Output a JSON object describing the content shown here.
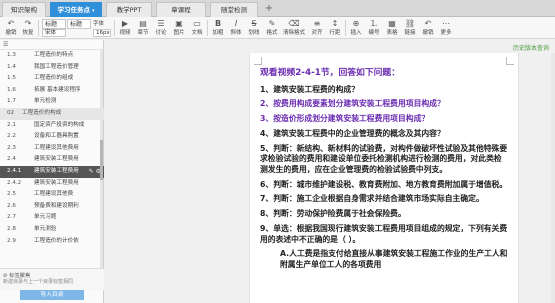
{
  "tabs": [
    {
      "label": "知识架构",
      "active": false
    },
    {
      "label": "学习任务点",
      "active": true,
      "caret": "▾"
    },
    {
      "label": "教学PPT",
      "active": false
    },
    {
      "label": "章课程",
      "active": false
    },
    {
      "label": "随堂检测",
      "active": false
    }
  ],
  "toolbar": {
    "undo": "撤销",
    "redo": "恢复",
    "heading_style": "标题",
    "body_style": "标题",
    "font_family": "宋体",
    "font_size": "16px",
    "font_name_label": "字体",
    "font_size_label": "字号",
    "buttons": [
      "视频",
      "章节",
      "讨论",
      "图片",
      "文档",
      "加粗",
      "斜体",
      "划线",
      "格式",
      "清除格式",
      "对齐",
      "行距",
      "插入",
      "编号",
      "表格",
      "链接",
      "撤销",
      "更多"
    ]
  },
  "sidebar": {
    "label_placeholder": "标签聚焦",
    "label_hint": "新建目录与上一个目录标签相同",
    "import_button": "导入目录",
    "rows": [
      {
        "num": "1.3",
        "text": "工程造价的特点",
        "type": "item"
      },
      {
        "num": "1.4",
        "text": "我国工程造价管理",
        "type": "item"
      },
      {
        "num": "1.5",
        "text": "工程造价的组成",
        "type": "item"
      },
      {
        "num": "1.6",
        "text": "拓展 基本建设程序",
        "type": "item"
      },
      {
        "num": "1.7",
        "text": "单元检测",
        "type": "item"
      },
      {
        "num": "02",
        "text": "工程造价的构成",
        "type": "chapter"
      },
      {
        "num": "2.1",
        "text": "国定资产投资的构成",
        "type": "item"
      },
      {
        "num": "2.2",
        "text": "设备和工器具购置",
        "type": "item"
      },
      {
        "num": "2.3",
        "text": "工程建设其他费用",
        "type": "item"
      },
      {
        "num": "2.4",
        "text": "建筑安装工程费用",
        "type": "item"
      },
      {
        "num": "2.4.1",
        "text": "建筑安装工程费用",
        "type": "selected"
      },
      {
        "num": "2.4.2",
        "text": "建筑安装工程费用",
        "type": "item"
      },
      {
        "num": "2.5",
        "text": "工程建设其他费",
        "type": "item"
      },
      {
        "num": "2.6",
        "text": "预备费和建设期利",
        "type": "item"
      },
      {
        "num": "2.7",
        "text": "单元习题",
        "type": "item"
      },
      {
        "num": "2.8",
        "text": "单元测验",
        "type": "item"
      },
      {
        "num": "2.9",
        "text": "工程造价的计价依",
        "type": "item"
      }
    ]
  },
  "editor": {
    "history_link": "历史版本查询",
    "title": "观看视频2-4-1节，回答如下问题：",
    "paragraphs": [
      {
        "text": "1、建筑安装工程费的构成？",
        "style": "normal"
      },
      {
        "text": "2、按费用构成要素划分建筑安装工程费用项目构成？",
        "style": "purple"
      },
      {
        "text": "3、按造价形成划分建筑安装工程费用项目构成？",
        "style": "purple"
      },
      {
        "text": "4、建筑安装工程费中的企业管理费的概念及其内容？",
        "style": "normal"
      },
      {
        "text": "5、判断：新结构、新材料的试验费，对构件做破坏性试验及其他特殊要求检验试验的费用和建设单位委托检测机构进行检测的费用，对此类检测发生的费用，应在企业管理费的检验试验费中列支。",
        "style": "normal"
      },
      {
        "text": "6、判断：城市维护建设税、教育费附加、地方教育费附加属于增值税。",
        "style": "normal"
      },
      {
        "text": "7、判断：施工企业根据自身需求并结合建筑市场实际自主确定。",
        "style": "normal"
      },
      {
        "text": "8、判断：劳动保护险费属于社会保险费。",
        "style": "normal"
      },
      {
        "text": "9、单选：根据我国现行建筑安装工程费用项目组成的规定，下列有关费用的表述中不正确的是（    ）。",
        "style": "normal"
      },
      {
        "text": "A.人工费是指支付给直接从事建筑安装工程施工作业的生产工人和附属生产单位工人的各项费用",
        "style": "option"
      }
    ]
  }
}
